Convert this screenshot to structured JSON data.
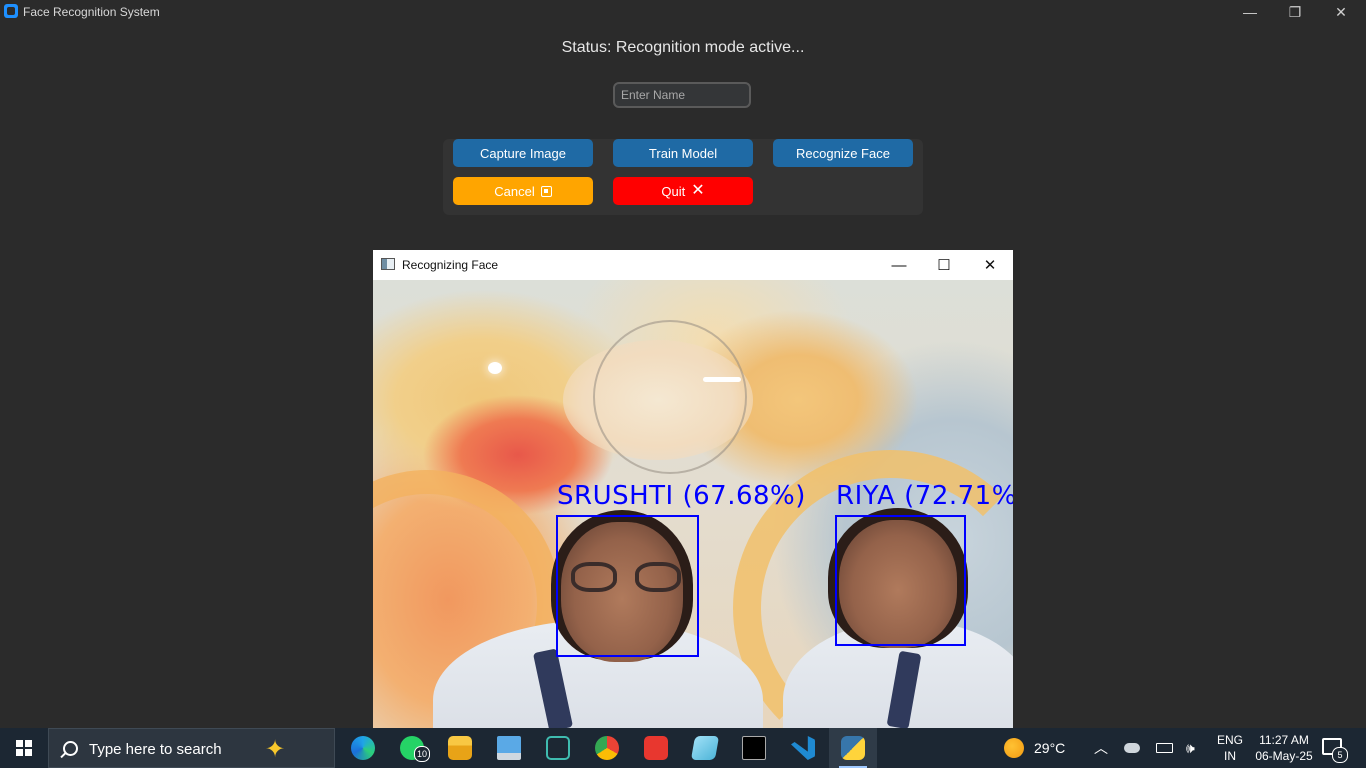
{
  "window": {
    "title": "Face Recognition System",
    "minimize_glyph": "—",
    "restore_glyph": "❐",
    "close_glyph": "✕"
  },
  "status": {
    "text": "Status: Recognition mode active..."
  },
  "name_input": {
    "value": "",
    "placeholder": "Enter Name"
  },
  "buttons": {
    "capture": "Capture Image",
    "train": "Train Model",
    "recognize": "Recognize Face",
    "cancel": "Cancel",
    "quit": "Quit",
    "quit_glyph": "✕"
  },
  "colors": {
    "background": "#2b2b2b",
    "primary_button": "#1f6aa5",
    "cancel_button": "#ffa500",
    "quit_button": "#ff0000",
    "face_box": "#0000ff"
  },
  "camera_window": {
    "title": "Recognizing Face",
    "minimize_glyph": "—",
    "maximize_glyph": "☐",
    "close_glyph": "✕",
    "detections": [
      {
        "label": "SRUSHTI (67.68%)"
      },
      {
        "label": "RIYA (72.71%"
      }
    ]
  },
  "taskbar": {
    "search_placeholder": "Type here to search",
    "apps": [
      {
        "icon": "edge-icon"
      },
      {
        "icon": "whatsapp-icon",
        "badge": "10"
      },
      {
        "icon": "file-explorer-icon"
      },
      {
        "icon": "laptop-icon"
      },
      {
        "icon": "vb-studio-icon"
      },
      {
        "icon": "chrome-icon"
      },
      {
        "icon": "wps-office-icon"
      },
      {
        "icon": "notepad-icon"
      },
      {
        "icon": "terminal-icon"
      },
      {
        "icon": "vscode-icon"
      },
      {
        "icon": "python-icon",
        "active": true
      }
    ],
    "weather": "29°C",
    "language_line1": "ENG",
    "language_line2": "IN",
    "time": "11:27 AM",
    "date": "06-May-25",
    "notification_count": "5"
  }
}
